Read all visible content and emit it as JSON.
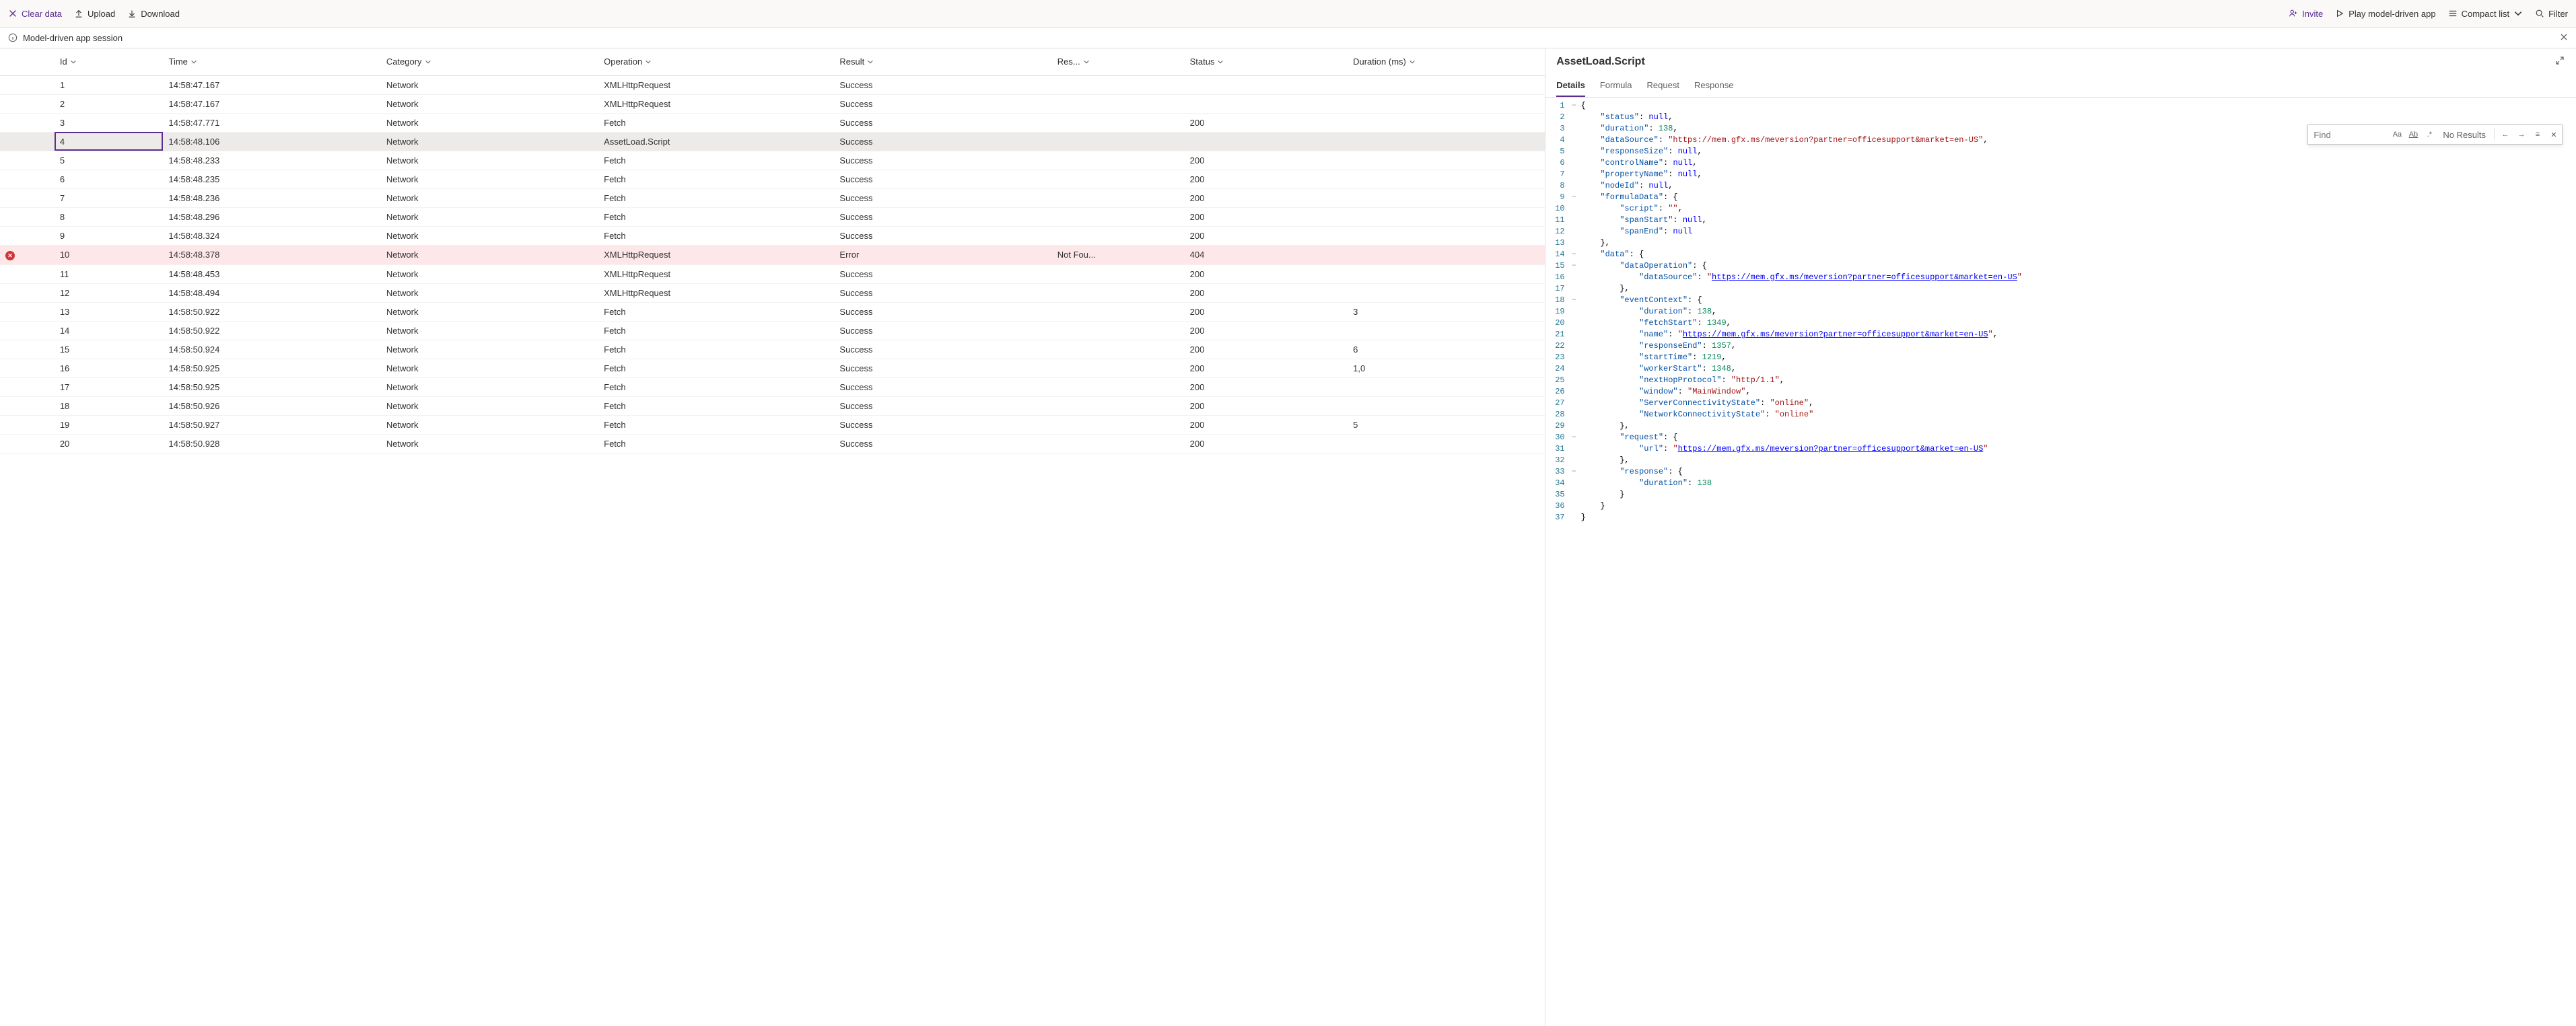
{
  "toolbar": {
    "clear": "Clear data",
    "upload": "Upload",
    "download": "Download",
    "invite": "Invite",
    "play": "Play model-driven app",
    "compact": "Compact list",
    "filter": "Filter"
  },
  "session": {
    "label": "Model-driven app session"
  },
  "columns": {
    "id": "Id",
    "time": "Time",
    "category": "Category",
    "operation": "Operation",
    "result": "Result",
    "response": "Res...",
    "status": "Status",
    "duration": "Duration (ms)"
  },
  "rows": [
    {
      "id": "1",
      "time": "14:58:47.167",
      "category": "Network",
      "operation": "XMLHttpRequest",
      "result": "Success",
      "response": "",
      "status": "",
      "duration": "",
      "flag": ""
    },
    {
      "id": "2",
      "time": "14:58:47.167",
      "category": "Network",
      "operation": "XMLHttpRequest",
      "result": "Success",
      "response": "",
      "status": "",
      "duration": "",
      "flag": ""
    },
    {
      "id": "3",
      "time": "14:58:47.771",
      "category": "Network",
      "operation": "Fetch",
      "result": "Success",
      "response": "",
      "status": "200",
      "duration": "",
      "flag": ""
    },
    {
      "id": "4",
      "time": "14:58:48.106",
      "category": "Network",
      "operation": "AssetLoad.Script",
      "result": "Success",
      "response": "",
      "status": "",
      "duration": "",
      "flag": "selected"
    },
    {
      "id": "5",
      "time": "14:58:48.233",
      "category": "Network",
      "operation": "Fetch",
      "result": "Success",
      "response": "",
      "status": "200",
      "duration": "",
      "flag": ""
    },
    {
      "id": "6",
      "time": "14:58:48.235",
      "category": "Network",
      "operation": "Fetch",
      "result": "Success",
      "response": "",
      "status": "200",
      "duration": "",
      "flag": ""
    },
    {
      "id": "7",
      "time": "14:58:48.236",
      "category": "Network",
      "operation": "Fetch",
      "result": "Success",
      "response": "",
      "status": "200",
      "duration": "",
      "flag": ""
    },
    {
      "id": "8",
      "time": "14:58:48.296",
      "category": "Network",
      "operation": "Fetch",
      "result": "Success",
      "response": "",
      "status": "200",
      "duration": "",
      "flag": ""
    },
    {
      "id": "9",
      "time": "14:58:48.324",
      "category": "Network",
      "operation": "Fetch",
      "result": "Success",
      "response": "",
      "status": "200",
      "duration": "",
      "flag": ""
    },
    {
      "id": "10",
      "time": "14:58:48.378",
      "category": "Network",
      "operation": "XMLHttpRequest",
      "result": "Error",
      "response": "Not Fou...",
      "status": "404",
      "duration": "",
      "flag": "error"
    },
    {
      "id": "11",
      "time": "14:58:48.453",
      "category": "Network",
      "operation": "XMLHttpRequest",
      "result": "Success",
      "response": "",
      "status": "200",
      "duration": "",
      "flag": ""
    },
    {
      "id": "12",
      "time": "14:58:48.494",
      "category": "Network",
      "operation": "XMLHttpRequest",
      "result": "Success",
      "response": "",
      "status": "200",
      "duration": "",
      "flag": ""
    },
    {
      "id": "13",
      "time": "14:58:50.922",
      "category": "Network",
      "operation": "Fetch",
      "result": "Success",
      "response": "",
      "status": "200",
      "duration": "3",
      "flag": ""
    },
    {
      "id": "14",
      "time": "14:58:50.922",
      "category": "Network",
      "operation": "Fetch",
      "result": "Success",
      "response": "",
      "status": "200",
      "duration": "",
      "flag": ""
    },
    {
      "id": "15",
      "time": "14:58:50.924",
      "category": "Network",
      "operation": "Fetch",
      "result": "Success",
      "response": "",
      "status": "200",
      "duration": "6",
      "flag": ""
    },
    {
      "id": "16",
      "time": "14:58:50.925",
      "category": "Network",
      "operation": "Fetch",
      "result": "Success",
      "response": "",
      "status": "200",
      "duration": "1,0",
      "flag": ""
    },
    {
      "id": "17",
      "time": "14:58:50.925",
      "category": "Network",
      "operation": "Fetch",
      "result": "Success",
      "response": "",
      "status": "200",
      "duration": "",
      "flag": ""
    },
    {
      "id": "18",
      "time": "14:58:50.926",
      "category": "Network",
      "operation": "Fetch",
      "result": "Success",
      "response": "",
      "status": "200",
      "duration": "",
      "flag": ""
    },
    {
      "id": "19",
      "time": "14:58:50.927",
      "category": "Network",
      "operation": "Fetch",
      "result": "Success",
      "response": "",
      "status": "200",
      "duration": "5",
      "flag": ""
    },
    {
      "id": "20",
      "time": "14:58:50.928",
      "category": "Network",
      "operation": "Fetch",
      "result": "Success",
      "response": "",
      "status": "200",
      "duration": "",
      "flag": ""
    }
  ],
  "detail": {
    "title": "AssetLoad.Script",
    "tabs": {
      "details": "Details",
      "formula": "Formula",
      "request": "Request",
      "response": "Response"
    }
  },
  "find": {
    "placeholder": "Find",
    "status": "No Results"
  },
  "code": [
    {
      "n": 1,
      "fold": "−",
      "t": [
        [
          "pun",
          "{"
        ]
      ]
    },
    {
      "n": 2,
      "fold": "",
      "t": [
        [
          "pun",
          "    "
        ],
        [
          "key",
          "\"status\""
        ],
        [
          "pun",
          ": "
        ],
        [
          "null",
          "null"
        ],
        [
          "pun",
          ","
        ]
      ]
    },
    {
      "n": 3,
      "fold": "",
      "t": [
        [
          "pun",
          "    "
        ],
        [
          "key",
          "\"duration\""
        ],
        [
          "pun",
          ": "
        ],
        [
          "num",
          "138"
        ],
        [
          "pun",
          ","
        ]
      ]
    },
    {
      "n": 4,
      "fold": "",
      "t": [
        [
          "pun",
          "    "
        ],
        [
          "key",
          "\"dataSource\""
        ],
        [
          "pun",
          ": "
        ],
        [
          "str",
          "\"https://mem.gfx.ms/meversion?partner=officesupport&market=en-US\""
        ],
        [
          "pun",
          ","
        ]
      ]
    },
    {
      "n": 5,
      "fold": "",
      "t": [
        [
          "pun",
          "    "
        ],
        [
          "key",
          "\"responseSize\""
        ],
        [
          "pun",
          ": "
        ],
        [
          "null",
          "null"
        ],
        [
          "pun",
          ","
        ]
      ]
    },
    {
      "n": 6,
      "fold": "",
      "t": [
        [
          "pun",
          "    "
        ],
        [
          "key",
          "\"controlName\""
        ],
        [
          "pun",
          ": "
        ],
        [
          "null",
          "null"
        ],
        [
          "pun",
          ","
        ]
      ]
    },
    {
      "n": 7,
      "fold": "",
      "t": [
        [
          "pun",
          "    "
        ],
        [
          "key",
          "\"propertyName\""
        ],
        [
          "pun",
          ": "
        ],
        [
          "null",
          "null"
        ],
        [
          "pun",
          ","
        ]
      ]
    },
    {
      "n": 8,
      "fold": "",
      "t": [
        [
          "pun",
          "    "
        ],
        [
          "key",
          "\"nodeId\""
        ],
        [
          "pun",
          ": "
        ],
        [
          "null",
          "null"
        ],
        [
          "pun",
          ","
        ]
      ]
    },
    {
      "n": 9,
      "fold": "−",
      "t": [
        [
          "pun",
          "    "
        ],
        [
          "key",
          "\"formulaData\""
        ],
        [
          "pun",
          ": {"
        ]
      ]
    },
    {
      "n": 10,
      "fold": "",
      "t": [
        [
          "pun",
          "        "
        ],
        [
          "key",
          "\"script\""
        ],
        [
          "pun",
          ": "
        ],
        [
          "str",
          "\"\""
        ],
        [
          "pun",
          ","
        ]
      ]
    },
    {
      "n": 11,
      "fold": "",
      "t": [
        [
          "pun",
          "        "
        ],
        [
          "key",
          "\"spanStart\""
        ],
        [
          "pun",
          ": "
        ],
        [
          "null",
          "null"
        ],
        [
          "pun",
          ","
        ]
      ]
    },
    {
      "n": 12,
      "fold": "",
      "t": [
        [
          "pun",
          "        "
        ],
        [
          "key",
          "\"spanEnd\""
        ],
        [
          "pun",
          ": "
        ],
        [
          "null",
          "null"
        ]
      ]
    },
    {
      "n": 13,
      "fold": "",
      "t": [
        [
          "pun",
          "    },"
        ]
      ]
    },
    {
      "n": 14,
      "fold": "−",
      "t": [
        [
          "pun",
          "    "
        ],
        [
          "key",
          "\"data\""
        ],
        [
          "pun",
          ": {"
        ]
      ]
    },
    {
      "n": 15,
      "fold": "−",
      "t": [
        [
          "pun",
          "        "
        ],
        [
          "key",
          "\"dataOperation\""
        ],
        [
          "pun",
          ": {"
        ]
      ]
    },
    {
      "n": 16,
      "fold": "",
      "t": [
        [
          "pun",
          "            "
        ],
        [
          "key",
          "\"dataSource\""
        ],
        [
          "pun",
          ": "
        ],
        [
          "str",
          "\""
        ],
        [
          "url",
          "https://mem.gfx.ms/meversion?partner=officesupport&market=en-US"
        ],
        [
          "str",
          "\""
        ]
      ]
    },
    {
      "n": 17,
      "fold": "",
      "t": [
        [
          "pun",
          "        },"
        ]
      ]
    },
    {
      "n": 18,
      "fold": "−",
      "t": [
        [
          "pun",
          "        "
        ],
        [
          "key",
          "\"eventContext\""
        ],
        [
          "pun",
          ": {"
        ]
      ]
    },
    {
      "n": 19,
      "fold": "",
      "t": [
        [
          "pun",
          "            "
        ],
        [
          "key",
          "\"duration\""
        ],
        [
          "pun",
          ": "
        ],
        [
          "num",
          "138"
        ],
        [
          "pun",
          ","
        ]
      ]
    },
    {
      "n": 20,
      "fold": "",
      "t": [
        [
          "pun",
          "            "
        ],
        [
          "key",
          "\"fetchStart\""
        ],
        [
          "pun",
          ": "
        ],
        [
          "num",
          "1349"
        ],
        [
          "pun",
          ","
        ]
      ]
    },
    {
      "n": 21,
      "fold": "",
      "t": [
        [
          "pun",
          "            "
        ],
        [
          "key",
          "\"name\""
        ],
        [
          "pun",
          ": "
        ],
        [
          "str",
          "\""
        ],
        [
          "url",
          "https://mem.gfx.ms/meversion?partner=officesupport&market=en-US"
        ],
        [
          "str",
          "\""
        ],
        [
          "pun",
          ","
        ]
      ]
    },
    {
      "n": 22,
      "fold": "",
      "t": [
        [
          "pun",
          "            "
        ],
        [
          "key",
          "\"responseEnd\""
        ],
        [
          "pun",
          ": "
        ],
        [
          "num",
          "1357"
        ],
        [
          "pun",
          ","
        ]
      ]
    },
    {
      "n": 23,
      "fold": "",
      "t": [
        [
          "pun",
          "            "
        ],
        [
          "key",
          "\"startTime\""
        ],
        [
          "pun",
          ": "
        ],
        [
          "num",
          "1219"
        ],
        [
          "pun",
          ","
        ]
      ]
    },
    {
      "n": 24,
      "fold": "",
      "t": [
        [
          "pun",
          "            "
        ],
        [
          "key",
          "\"workerStart\""
        ],
        [
          "pun",
          ": "
        ],
        [
          "num",
          "1348"
        ],
        [
          "pun",
          ","
        ]
      ]
    },
    {
      "n": 25,
      "fold": "",
      "t": [
        [
          "pun",
          "            "
        ],
        [
          "key",
          "\"nextHopProtocol\""
        ],
        [
          "pun",
          ": "
        ],
        [
          "str",
          "\"http/1.1\""
        ],
        [
          "pun",
          ","
        ]
      ]
    },
    {
      "n": 26,
      "fold": "",
      "t": [
        [
          "pun",
          "            "
        ],
        [
          "key",
          "\"window\""
        ],
        [
          "pun",
          ": "
        ],
        [
          "str",
          "\"MainWindow\""
        ],
        [
          "pun",
          ","
        ]
      ]
    },
    {
      "n": 27,
      "fold": "",
      "t": [
        [
          "pun",
          "            "
        ],
        [
          "key",
          "\"ServerConnectivityState\""
        ],
        [
          "pun",
          ": "
        ],
        [
          "str",
          "\"online\""
        ],
        [
          "pun",
          ","
        ]
      ]
    },
    {
      "n": 28,
      "fold": "",
      "t": [
        [
          "pun",
          "            "
        ],
        [
          "key",
          "\"NetworkConnectivityState\""
        ],
        [
          "pun",
          ": "
        ],
        [
          "str",
          "\"online\""
        ]
      ]
    },
    {
      "n": 29,
      "fold": "",
      "t": [
        [
          "pun",
          "        },"
        ]
      ]
    },
    {
      "n": 30,
      "fold": "−",
      "t": [
        [
          "pun",
          "        "
        ],
        [
          "key",
          "\"request\""
        ],
        [
          "pun",
          ": {"
        ]
      ]
    },
    {
      "n": 31,
      "fold": "",
      "t": [
        [
          "pun",
          "            "
        ],
        [
          "key",
          "\"url\""
        ],
        [
          "pun",
          ": "
        ],
        [
          "str",
          "\""
        ],
        [
          "url",
          "https://mem.gfx.ms/meversion?partner=officesupport&market=en-US"
        ],
        [
          "str",
          "\""
        ]
      ]
    },
    {
      "n": 32,
      "fold": "",
      "t": [
        [
          "pun",
          "        },"
        ]
      ]
    },
    {
      "n": 33,
      "fold": "−",
      "t": [
        [
          "pun",
          "        "
        ],
        [
          "key",
          "\"response\""
        ],
        [
          "pun",
          ": {"
        ]
      ]
    },
    {
      "n": 34,
      "fold": "",
      "t": [
        [
          "pun",
          "            "
        ],
        [
          "key",
          "\"duration\""
        ],
        [
          "pun",
          ": "
        ],
        [
          "num",
          "138"
        ]
      ]
    },
    {
      "n": 35,
      "fold": "",
      "t": [
        [
          "pun",
          "        }"
        ]
      ]
    },
    {
      "n": 36,
      "fold": "",
      "t": [
        [
          "pun",
          "    }"
        ]
      ]
    },
    {
      "n": 37,
      "fold": "",
      "t": [
        [
          "pun",
          "}"
        ]
      ]
    }
  ]
}
